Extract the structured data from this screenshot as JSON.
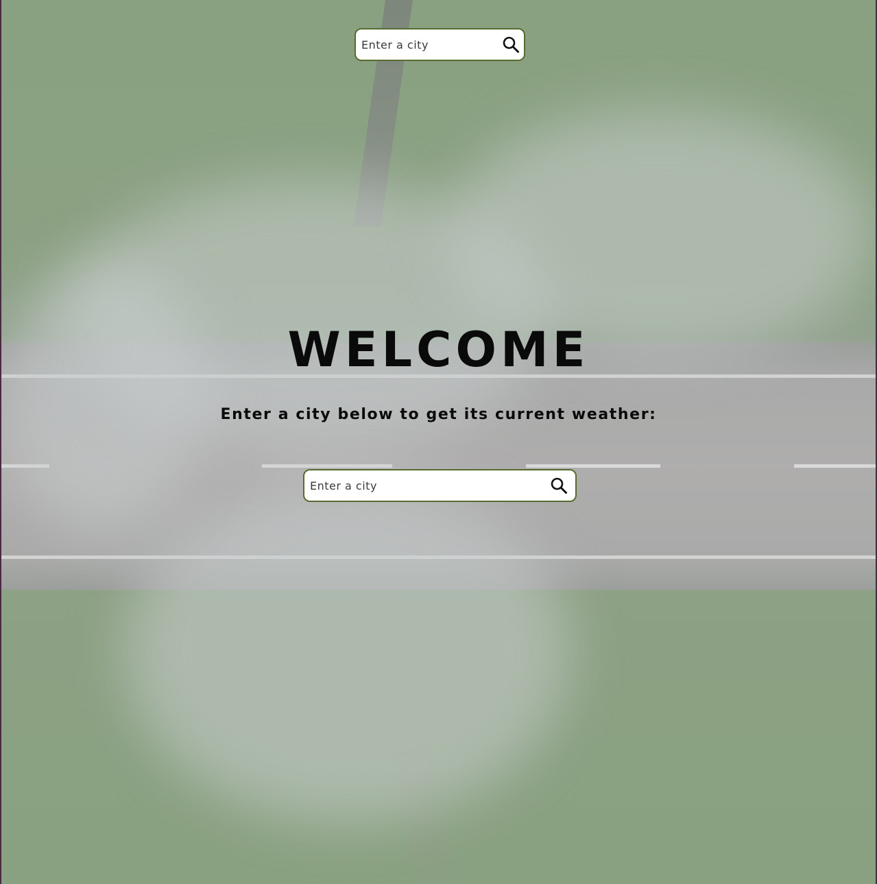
{
  "header": {
    "search": {
      "placeholder": "Enter a city",
      "icon": "search-icon"
    }
  },
  "main": {
    "title": "WELCOME",
    "subtitle": "Enter a city below to get its current weather:",
    "search": {
      "placeholder": "Enter a city",
      "icon": "search-icon"
    }
  },
  "colors": {
    "input_border": "#556b2f",
    "text": "#0a0a0a",
    "input_bg": "#ffffff"
  }
}
